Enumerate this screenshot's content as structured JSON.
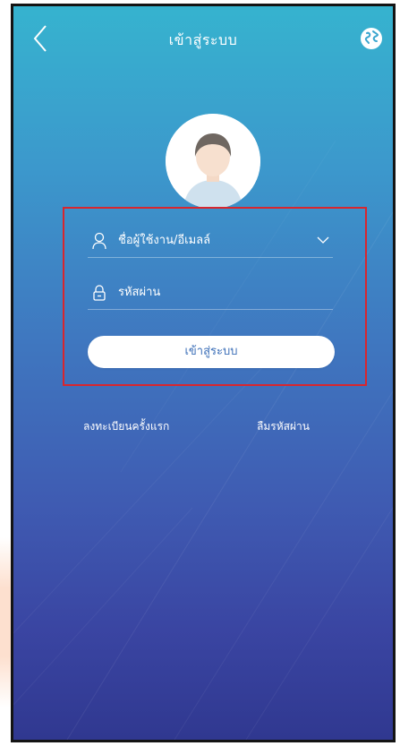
{
  "header": {
    "title": "เข้าสู่ระบบ",
    "back_icon": "chevron-left-icon",
    "language_icon": "globe-icon"
  },
  "avatar": {
    "icon": "user-avatar-icon"
  },
  "form": {
    "username_placeholder": "ชื่อผู้ใช้งาน/อีเมลล์",
    "username_icon": "user-icon",
    "dropdown_icon": "chevron-down-icon",
    "password_placeholder": "รหัสผ่าน",
    "password_icon": "lock-icon",
    "login_label": "เข้าสู่ระบบ"
  },
  "links": {
    "register": "ลงทะเบียนครั้งแรก",
    "forgot_password": "ลืมรหัสผ่าน"
  },
  "colors": {
    "bg_top": "#36b3cf",
    "bg_bottom": "#303890",
    "highlight_border": "#d8262e",
    "button_text": "#3c6fb8"
  }
}
